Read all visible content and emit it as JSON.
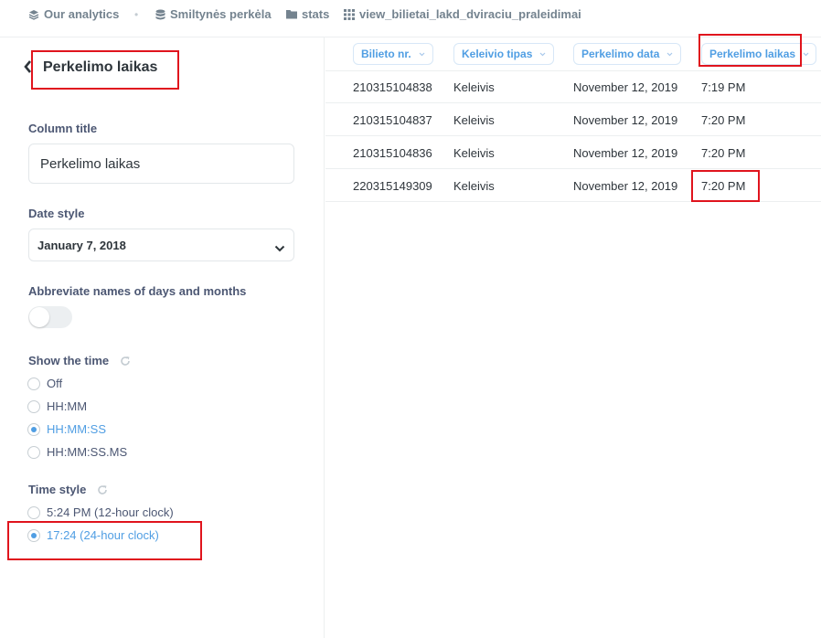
{
  "breadcrumb": {
    "collection": "Our analytics",
    "database": "Smiltynės perkėla",
    "schema": "stats",
    "table": "view_bilietai_lakd_dviraciu_praleidimai"
  },
  "sidebar": {
    "title": "Perkelimo laikas",
    "column_title_label": "Column title",
    "column_title_value": "Perkelimo laikas",
    "date_style_label": "Date style",
    "date_style_value": "January 7, 2018",
    "abbreviate_label": "Abbreviate names of days and months",
    "abbreviate_on": false,
    "show_time_label": "Show the time",
    "show_time_options": [
      "Off",
      "HH:MM",
      "HH:MM:SS",
      "HH:MM:SS.MS"
    ],
    "show_time_selected": "HH:MM:SS",
    "time_style_label": "Time style",
    "time_style_options": [
      "5:24 PM (12-hour clock)",
      "17:24 (24-hour clock)"
    ],
    "time_style_selected": "17:24 (24-hour clock)"
  },
  "table": {
    "columns": [
      "Bilieto nr.",
      "Keleivio tipas",
      "Perkelimo data",
      "Perkelimo laikas"
    ],
    "rows": [
      [
        "210315104838",
        "Keleivis",
        "November 12, 2019",
        "7:19 PM"
      ],
      [
        "210315104837",
        "Keleivis",
        "November 12, 2019",
        "7:20 PM"
      ],
      [
        "210315104836",
        "Keleivis",
        "November 12, 2019",
        "7:20 PM"
      ],
      [
        "220315149309",
        "Keleivis",
        "November 12, 2019",
        "7:20 PM"
      ]
    ]
  },
  "colors": {
    "accent": "#509ee3",
    "highlight": "#e0141d",
    "text": "#2e353b"
  }
}
